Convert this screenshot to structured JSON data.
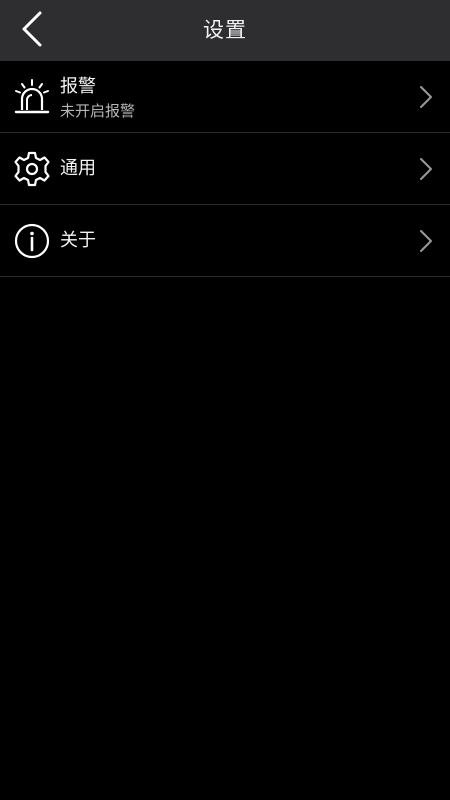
{
  "header": {
    "title": "设置",
    "back_icon": "chevron-left-icon"
  },
  "menu": {
    "items": [
      {
        "id": "alarm",
        "label": "报警",
        "sublabel": "未开启报警",
        "icon": "alarm-light-icon"
      },
      {
        "id": "general",
        "label": "通用",
        "icon": "gear-icon"
      },
      {
        "id": "about",
        "label": "关于",
        "icon": "info-icon"
      }
    ]
  },
  "colors": {
    "background": "#000000",
    "header_bg": "#2e2e31",
    "divider": "#2a2a2a",
    "text_primary": "#f5f5f5",
    "text_secondary": "#b5b5b5",
    "icon": "#ffffff",
    "chevron": "#9a9a9a"
  }
}
